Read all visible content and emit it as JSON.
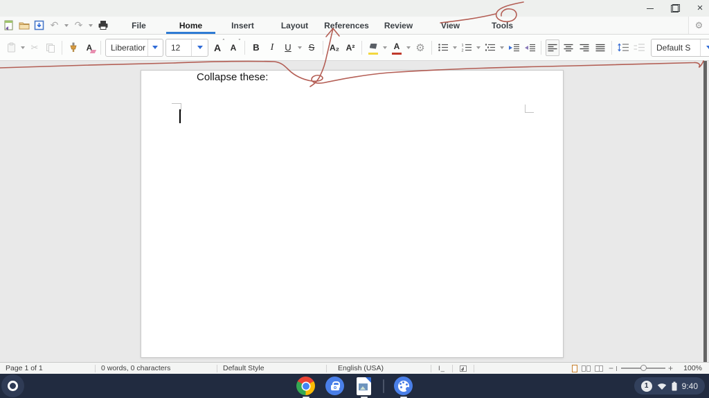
{
  "tabs": {
    "items": [
      "File",
      "Home",
      "Insert",
      "Layout",
      "References",
      "Review",
      "View",
      "Tools"
    ],
    "active": "Home"
  },
  "toolbar": {
    "font_name": "Liberatior",
    "font_size": "12",
    "increase_font": "A",
    "decrease_font": "A",
    "bold": "B",
    "italic": "I",
    "underline": "U",
    "strikethrough": "S",
    "subscript": "A₂",
    "superscript": "A²",
    "clear_format_letter": "A",
    "font_color_letter": "A",
    "style_name": "Default S",
    "overflow": "»",
    "context": "Home"
  },
  "icons": {
    "gear": "⚙",
    "cut": "✂",
    "undo": "↶",
    "redo": "↷",
    "close": "×"
  },
  "document": {
    "annotation_text": "Collapse these:"
  },
  "statusbar": {
    "page": "Page 1 of 1",
    "words": "0 words, 0 characters",
    "style": "Default Style",
    "language": "English (USA)",
    "insert_mode": "I_",
    "zoom_level": "100%"
  },
  "shelf": {
    "notifications": "1",
    "time": "9:40"
  },
  "colors": {
    "accent_blue": "#2e7bd4",
    "annotation_red": "#ae5147",
    "shelf_bg": "#212b40",
    "highlight_yellow": "#f3d73e",
    "font_color_red": "#c0392b",
    "scrollbar_gray": "#646464"
  }
}
